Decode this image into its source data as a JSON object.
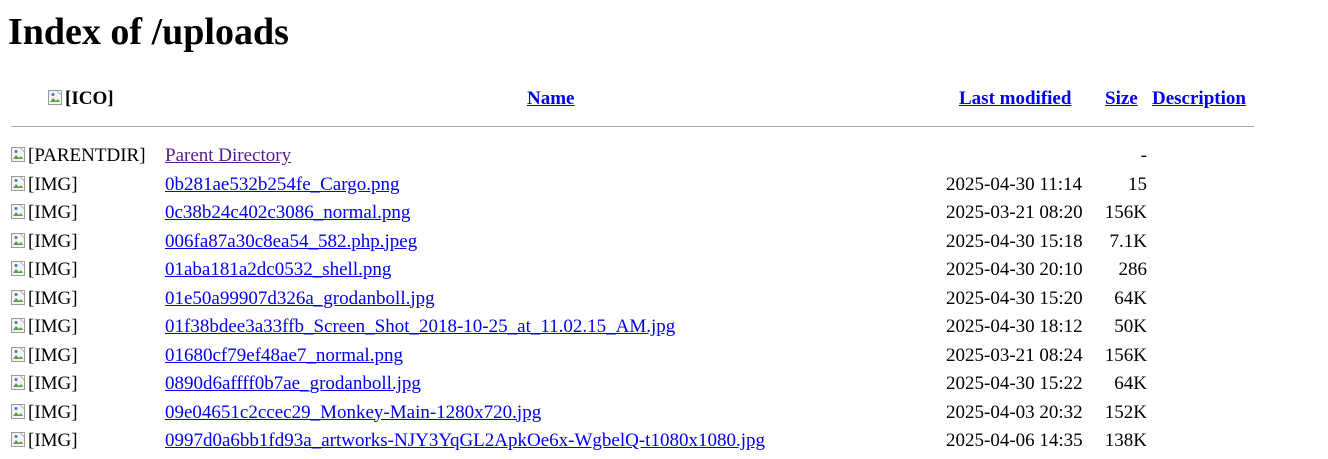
{
  "page": {
    "title": "Index of /uploads"
  },
  "header": {
    "icon_alt": "[ICO]",
    "name": "Name",
    "last_modified": "Last modified",
    "size": "Size",
    "description": "Description"
  },
  "rows": [
    {
      "icon": "broken-image-icon",
      "alt": "[PARENTDIR]",
      "name": "Parent Directory",
      "modified": "",
      "size": "-",
      "visited": true
    },
    {
      "icon": "broken-image-icon",
      "alt": "[IMG]",
      "name": "0b281ae532b254fe_Cargo.png",
      "modified": "2025-04-30 11:14",
      "size": "15"
    },
    {
      "icon": "broken-image-icon",
      "alt": "[IMG]",
      "name": "0c38b24c402c3086_normal.png",
      "modified": "2025-03-21 08:20",
      "size": "156K"
    },
    {
      "icon": "broken-image-icon",
      "alt": "[IMG]",
      "name": "006fa87a30c8ea54_582.php.jpeg",
      "modified": "2025-04-30 15:18",
      "size": "7.1K"
    },
    {
      "icon": "broken-image-icon",
      "alt": "[IMG]",
      "name": "01aba181a2dc0532_shell.png",
      "modified": "2025-04-30 20:10",
      "size": "286"
    },
    {
      "icon": "broken-image-icon",
      "alt": "[IMG]",
      "name": "01e50a99907d326a_grodanboll.jpg",
      "modified": "2025-04-30 15:20",
      "size": "64K"
    },
    {
      "icon": "broken-image-icon",
      "alt": "[IMG]",
      "name": "01f38bdee3a33ffb_Screen_Shot_2018-10-25_at_11.02.15_AM.jpg",
      "modified": "2025-04-30 18:12",
      "size": "50K"
    },
    {
      "icon": "broken-image-icon",
      "alt": "[IMG]",
      "name": "01680cf79ef48ae7_normal.png",
      "modified": "2025-03-21 08:24",
      "size": "156K"
    },
    {
      "icon": "broken-image-icon",
      "alt": "[IMG]",
      "name": "0890d6affff0b7ae_grodanboll.jpg",
      "modified": "2025-04-30 15:22",
      "size": "64K"
    },
    {
      "icon": "broken-image-icon",
      "alt": "[IMG]",
      "name": "09e04651c2ccec29_Monkey-Main-1280x720.jpg",
      "modified": "2025-04-03 20:32",
      "size": "152K"
    },
    {
      "icon": "broken-image-icon",
      "alt": "[IMG]",
      "name": "0997d0a6bb1fd93a_artworks-NJY3YqGL2ApkOe6x-WgbelQ-t1080x1080.jpg",
      "modified": "2025-04-06 14:35",
      "size": "138K"
    }
  ]
}
